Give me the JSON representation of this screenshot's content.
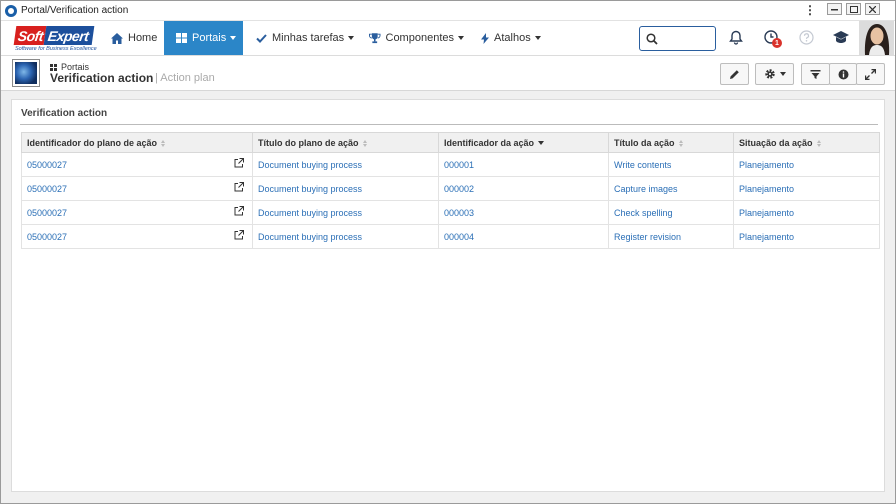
{
  "window": {
    "title": "Portal/Verification action",
    "menu_glyph": "⋮"
  },
  "brand": {
    "name_part1": "Soft",
    "name_part2": "Expert",
    "tagline": "Software for Business Excellence"
  },
  "nav": {
    "items": [
      {
        "label": "Home",
        "icon": "home-icon"
      },
      {
        "label": "Portais",
        "icon": "grid-icon",
        "active": true
      },
      {
        "label": "Minhas tarefas",
        "icon": "check-icon"
      },
      {
        "label": "Componentes",
        "icon": "trophy-icon"
      },
      {
        "label": "Atalhos",
        "icon": "bolt-icon"
      }
    ],
    "search_value": "",
    "notification_badge": "1"
  },
  "page": {
    "breadcrumb": "Portais",
    "title": "Verification action",
    "subtitle": "| Action plan"
  },
  "panel": {
    "title": "Verification action",
    "columns": [
      "Identificador do plano de ação",
      "Título do plano de ação",
      "Identificador da ação",
      "Título da ação",
      "Situação da ação"
    ],
    "rows": [
      {
        "plan_id": "05000027",
        "plan_title": "Document buying process",
        "action_id": "000001",
        "action_title": "Write contents",
        "status": "Planejamento"
      },
      {
        "plan_id": "05000027",
        "plan_title": "Document buying process",
        "action_id": "000002",
        "action_title": "Capture images",
        "status": "Planejamento"
      },
      {
        "plan_id": "05000027",
        "plan_title": "Document buying process",
        "action_id": "000003",
        "action_title": "Check spelling",
        "status": "Planejamento"
      },
      {
        "plan_id": "05000027",
        "plan_title": "Document buying process",
        "action_id": "000004",
        "action_title": "Register revision",
        "status": "Planejamento"
      }
    ]
  },
  "colors": {
    "accent": "#2b86c8",
    "link": "#2b6fb6",
    "brand_red": "#d8201e",
    "brand_blue": "#1c4f9c",
    "badge": "#d9322b"
  }
}
